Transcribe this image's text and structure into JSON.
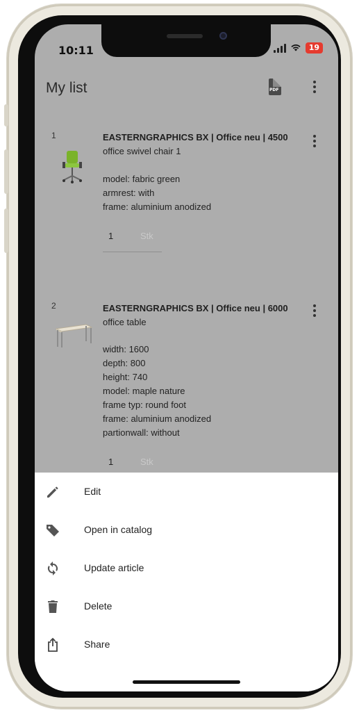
{
  "status_bar": {
    "time": "10:11",
    "battery": "19"
  },
  "header": {
    "title": "My list",
    "pdf_icon": "pdf-file-icon",
    "menu_icon": "more-vert-icon"
  },
  "items": [
    {
      "number": "1",
      "title": "EASTERNGRAPHICS BX | Office neu | 4500",
      "subtitle": "office swivel chair 1",
      "properties": [
        "model: fabric green",
        "armrest: with",
        "frame: aluminium anodized"
      ],
      "quantity": "1",
      "unit": "Stk"
    },
    {
      "number": "2",
      "title": "EASTERNGRAPHICS BX | Office neu | 6000",
      "subtitle": "office table",
      "properties": [
        "width: 1600",
        "depth: 800",
        "height: 740",
        "model: maple nature",
        "frame typ: round foot",
        "frame: aluminium anodized",
        "partionwall: without"
      ],
      "quantity": "1",
      "unit": "Stk"
    }
  ],
  "action_sheet": [
    {
      "label": "Edit",
      "icon": "pencil-icon"
    },
    {
      "label": "Open in catalog",
      "icon": "tag-icon"
    },
    {
      "label": "Update article",
      "icon": "sync-icon"
    },
    {
      "label": "Delete",
      "icon": "trash-icon"
    },
    {
      "label": "Share",
      "icon": "share-icon"
    }
  ],
  "colors": {
    "overlay": "#adadad",
    "battery": "#e53b2f",
    "icon": "#555555"
  }
}
